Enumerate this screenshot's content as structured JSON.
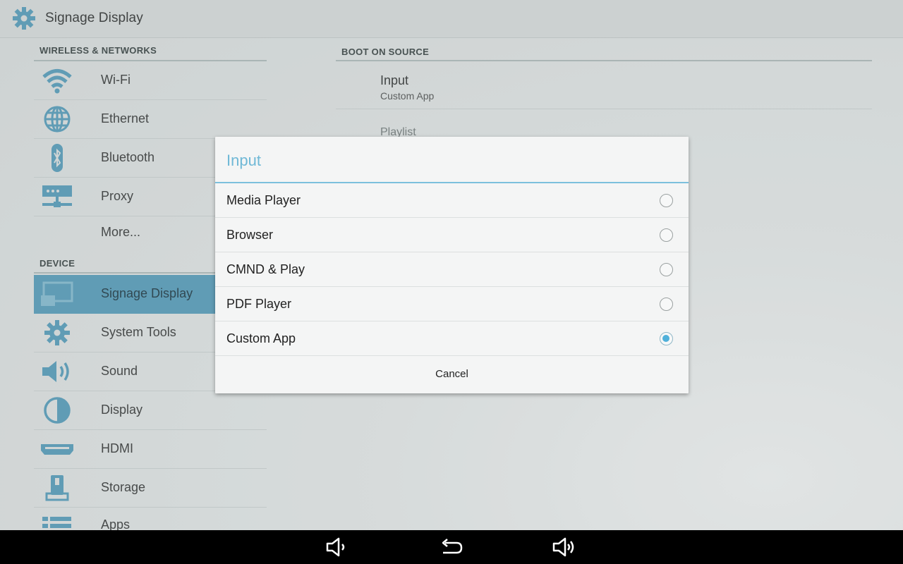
{
  "titlebar": {
    "title": "Signage Display",
    "icon": "gear-icon"
  },
  "sidebar": {
    "sections": [
      {
        "header": "WIRELESS & NETWORKS"
      },
      {
        "header": "DEVICE"
      }
    ],
    "items": [
      {
        "label": "Wi-Fi",
        "icon": "wifi-icon"
      },
      {
        "label": "Ethernet",
        "icon": "globe-icon"
      },
      {
        "label": "Bluetooth",
        "icon": "bluetooth-icon"
      },
      {
        "label": "Proxy",
        "icon": "proxy-icon"
      },
      {
        "label": "More...",
        "icon": ""
      },
      {
        "label": "Signage Display",
        "icon": "signage-display-icon",
        "selected": true
      },
      {
        "label": "System Tools",
        "icon": "gear-icon"
      },
      {
        "label": "Sound",
        "icon": "speaker-icon"
      },
      {
        "label": "Display",
        "icon": "brightness-icon"
      },
      {
        "label": "HDMI",
        "icon": "hdmi-icon"
      },
      {
        "label": "Storage",
        "icon": "storage-icon"
      },
      {
        "label": "Apps",
        "icon": "apps-icon"
      }
    ]
  },
  "main": {
    "section_header": "BOOT ON SOURCE",
    "pref_input": {
      "title": "Input",
      "summary": "Custom App"
    },
    "pref_playlist": {
      "title": "Playlist"
    }
  },
  "dialog": {
    "title": "Input",
    "options": [
      {
        "label": "Media Player",
        "checked": false
      },
      {
        "label": "Browser",
        "checked": false
      },
      {
        "label": "CMND & Play",
        "checked": false
      },
      {
        "label": "PDF Player",
        "checked": false
      },
      {
        "label": "Custom App",
        "checked": true
      }
    ],
    "cancel_label": "Cancel"
  },
  "navbar": {
    "buttons": [
      "volume-down-icon",
      "back-icon",
      "volume-up-icon"
    ]
  },
  "colors": {
    "accent": "#5aa3c3",
    "dialog_title": "#6fb8d6",
    "radio_checked": "#4fb0da",
    "navbar": "#000000"
  }
}
